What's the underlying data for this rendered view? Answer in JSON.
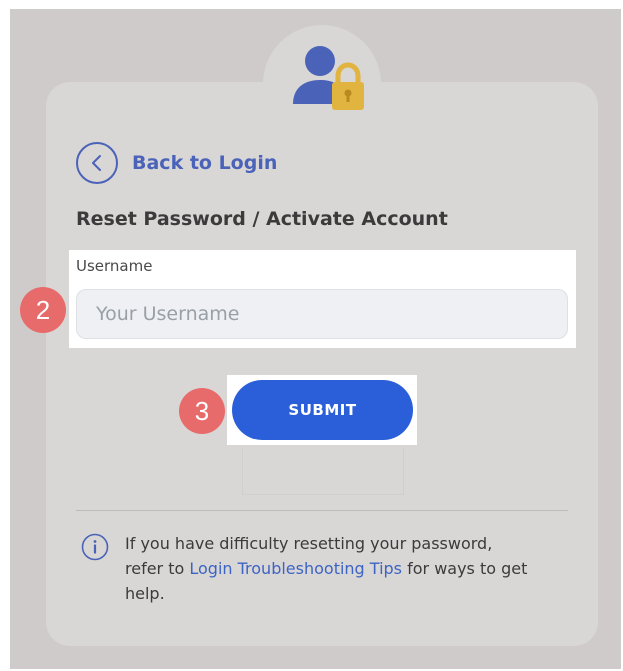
{
  "back_link": {
    "label": "Back to Login"
  },
  "page_title": "Reset Password / Activate Account",
  "username_field": {
    "label": "Username",
    "placeholder": "Your Username",
    "value": ""
  },
  "submit_button": {
    "label": "SUBMIT"
  },
  "annotations": {
    "step_username": "2",
    "step_submit": "3"
  },
  "help_notice": {
    "text_before": "If you have difficulty resetting your password, refer to ",
    "link_label": "Login Troubleshooting Tips",
    "text_after": " for ways to get help."
  },
  "icons": {
    "avatar": "user-lock-icon",
    "back": "chevron-left-icon",
    "info": "info-icon"
  },
  "colors": {
    "accent": "#4a63b8",
    "primary_button": "#2b5fd9",
    "badge": "#e86b6b",
    "lock": "#e1b33f",
    "backdrop": "#cfcbcb",
    "card": "#d9d6d6"
  }
}
